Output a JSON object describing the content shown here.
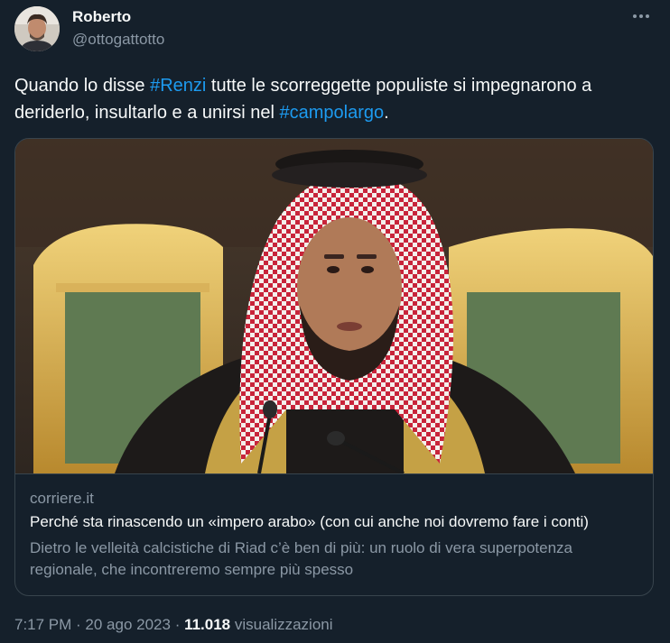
{
  "author": {
    "display_name": "Roberto",
    "handle": "@ottogattotto"
  },
  "more_icon": "more-horizontal-icon",
  "tweet": {
    "text_1": "Quando lo disse ",
    "hashtag_1": "#Renzi",
    "text_2": " tutte le scorreggette populiste si impegnarono a deriderlo, insultarlo e a unirsi nel ",
    "hashtag_2": "#campolargo",
    "text_3": "."
  },
  "card": {
    "domain": "corriere.it",
    "title": "Perché sta rinascendo un «impero arabo» (con cui anche noi dovremo fare i conti)",
    "description": "Dietro le velleità calcistiche di Riad c’è ben di più: un ruolo di vera superpotenza regionale, che incontreremo sempre più spesso"
  },
  "meta": {
    "time": "7:17 PM",
    "separator_1": " · ",
    "date": "20 ago 2023",
    "separator_2": " · ",
    "views_count": "11.018",
    "views_label": " visualizzazioni"
  },
  "colors": {
    "background": "#15202b",
    "text": "#f7f9f9",
    "secondary": "#8b98a5",
    "accent": "#1d9bf0",
    "border": "#38444d"
  }
}
